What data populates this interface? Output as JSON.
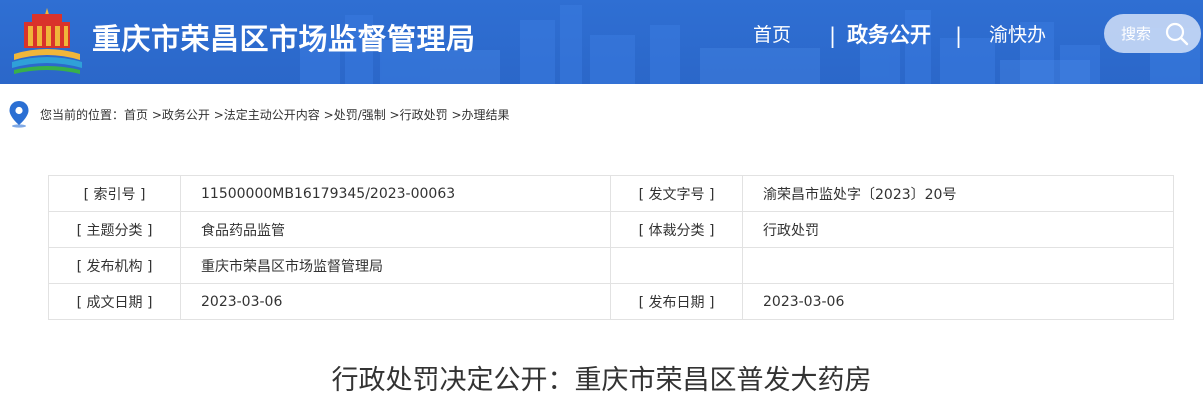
{
  "header": {
    "site_title": "重庆市荣昌区市场监督管理局",
    "nav": [
      {
        "label": "首页"
      },
      {
        "label": "政务公开"
      },
      {
        "label": "渝快办"
      }
    ],
    "nav_separator": "|",
    "search_label": "搜索"
  },
  "breadcrumb": {
    "prefix": "您当前的位置：",
    "items": [
      "首页",
      "政务公开",
      "法定主动公开内容",
      "处罚/强制",
      "行政处罚",
      "办理结果"
    ],
    "separator": " >"
  },
  "info": {
    "index_no_label": "[ 索引号 ]",
    "index_no": "11500000MB16179345/2023-00063",
    "doc_no_label": "[ 发文字号 ]",
    "doc_no": "渝荣昌市监处字〔2023〕20号",
    "topic_label": "[ 主题分类 ]",
    "topic": "食品药品监管",
    "genre_label": "[ 体裁分类 ]",
    "genre": "行政处罚",
    "publisher_label": "[ 发布机构 ]",
    "publisher": "重庆市荣昌区市场监督管理局",
    "created_label": "[ 成文日期 ]",
    "created": "2023-03-06",
    "published_label": "[ 发布日期 ]",
    "published": "2023-03-06"
  },
  "document": {
    "title": "行政处罚决定公开：重庆市荣昌区普发大药房"
  },
  "colors": {
    "header_blue": "#2b67c9",
    "logo_red": "#d9332b",
    "logo_gold": "#f0b63a",
    "border": "#e2e2e2"
  }
}
